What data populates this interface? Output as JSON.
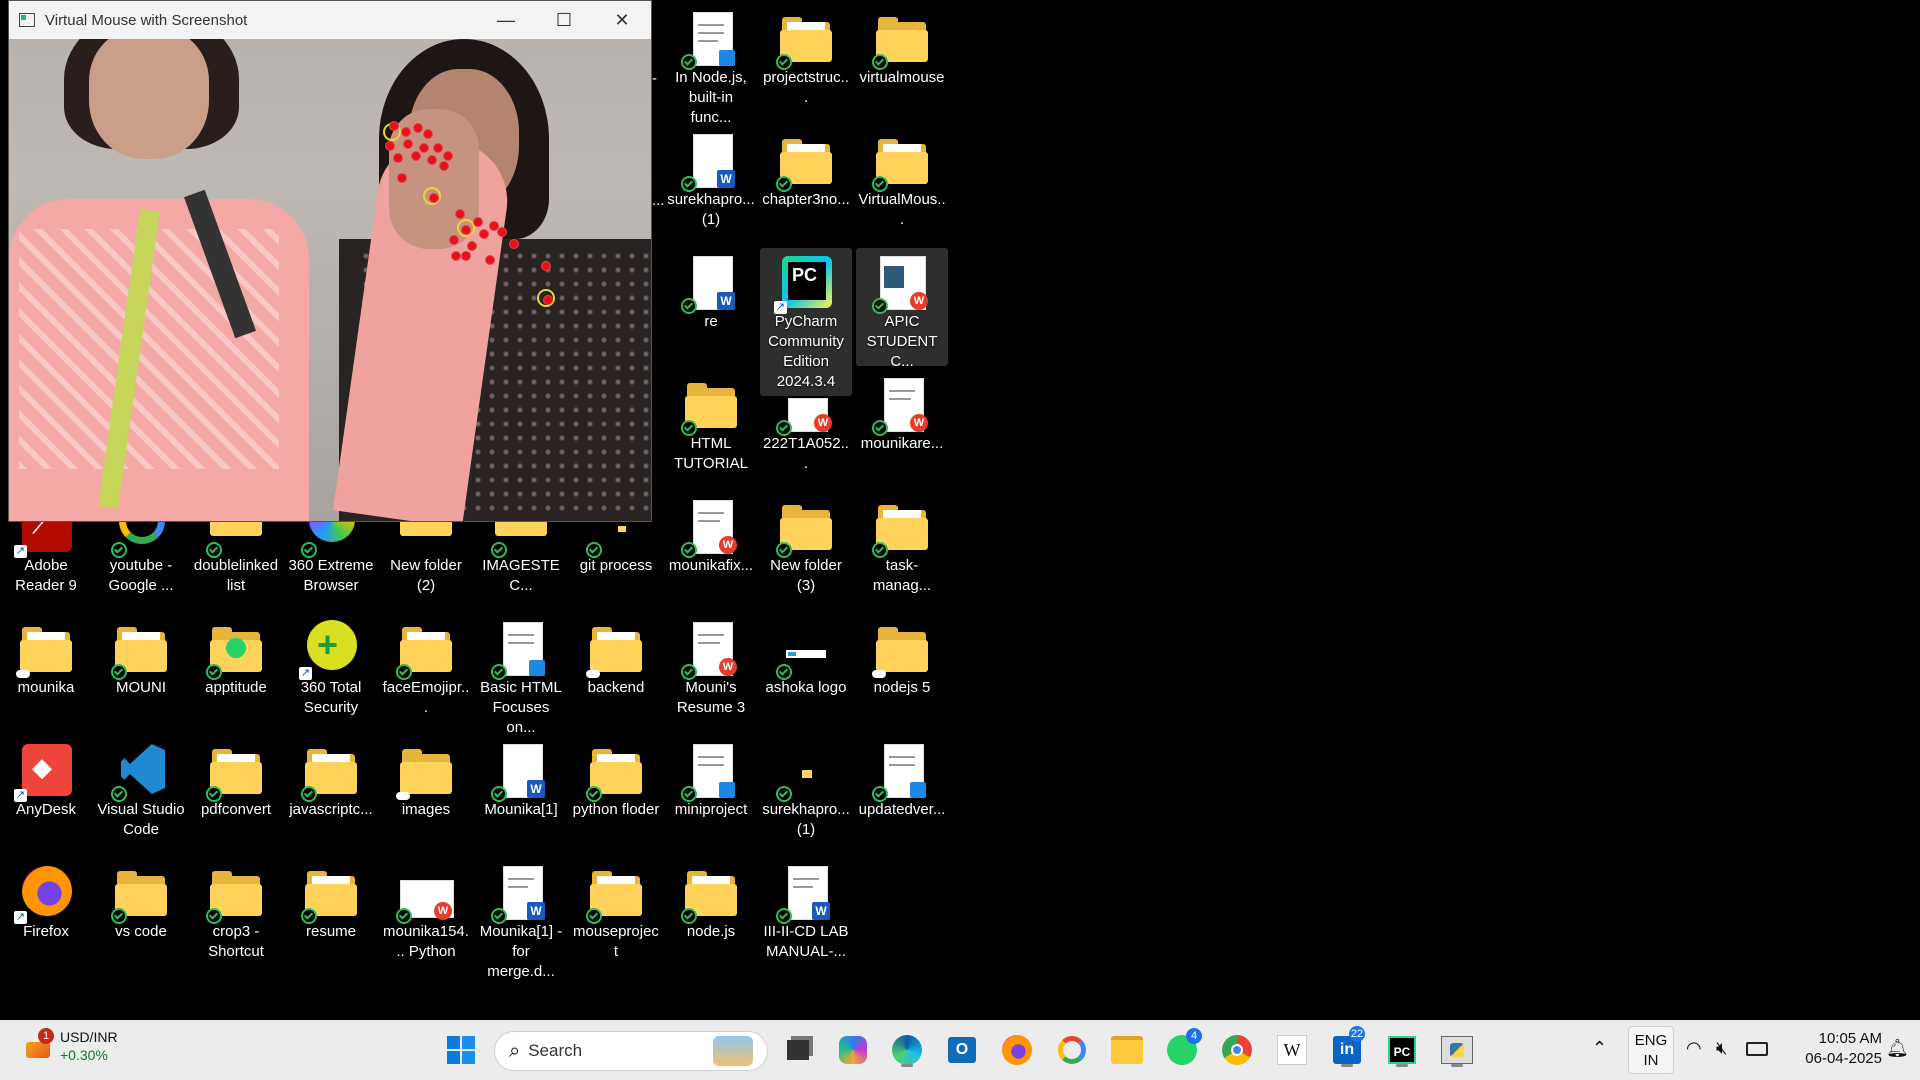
{
  "window": {
    "title": "Virtual Mouse with Screenshot",
    "minimize": "—",
    "maximize": "☐",
    "close": "✕"
  },
  "desktop_icons": [
    {
      "label": "In Node.js, built-in func...",
      "type": "doc-notepad",
      "status": "check"
    },
    {
      "label": "projectstruc...",
      "type": "folder",
      "status": "check"
    },
    {
      "label": "virtualmouse",
      "type": "folder",
      "status": "check"
    },
    {
      "label": "surekhapro... (1)",
      "type": "doc-word",
      "status": "check"
    },
    {
      "label": "chapter3no...",
      "type": "folder",
      "status": "check"
    },
    {
      "label": "VirtualMous...",
      "type": "folder",
      "status": "check"
    },
    {
      "label": "re",
      "type": "doc-word",
      "status": "check"
    },
    {
      "label": "PyCharm Community Edition 2024.3.4",
      "type": "app-pycharm",
      "status": "shortcut"
    },
    {
      "label": "APIC STUDENT C...",
      "type": "doc-wps",
      "status": "check"
    },
    {
      "label": "HTML TUTORIAL",
      "type": "folder",
      "status": "check"
    },
    {
      "label": "222T1A052...",
      "type": "doc-wps",
      "status": "check"
    },
    {
      "label": "mounikare...",
      "type": "doc-wps",
      "status": "check"
    },
    {
      "label": "Adobe Reader 9",
      "type": "app-adobe",
      "status": "shortcut"
    },
    {
      "label": "youtube - Google ...",
      "type": "app-google",
      "status": "check"
    },
    {
      "label": "doublelinked list",
      "type": "folder",
      "status": "check"
    },
    {
      "label": "360 Extreme Browser",
      "type": "app-360browser",
      "status": "check"
    },
    {
      "label": "New folder (2)",
      "type": "folder",
      "status": "check"
    },
    {
      "label": "IMAGESTEC...",
      "type": "folder",
      "status": "check"
    },
    {
      "label": "git process",
      "type": "folder",
      "status": "check"
    },
    {
      "label": "mounikafix...",
      "type": "doc-wps",
      "status": "check"
    },
    {
      "label": "New folder (3)",
      "type": "folder",
      "status": "check"
    },
    {
      "label": "task-manag...",
      "type": "folder",
      "status": "check"
    },
    {
      "label": "mounika",
      "type": "folder",
      "status": "cloud"
    },
    {
      "label": "MOUNI",
      "type": "folder",
      "status": "check"
    },
    {
      "label": "apptitude",
      "type": "folder-whatsapp",
      "status": "check"
    },
    {
      "label": "360 Total Security",
      "type": "app-360security",
      "status": "shortcut"
    },
    {
      "label": "faceEmojipr...",
      "type": "folder",
      "status": "check"
    },
    {
      "label": "Basic HTML Focuses on...",
      "type": "doc-notepad",
      "status": "check"
    },
    {
      "label": "backend",
      "type": "folder",
      "status": "cloud"
    },
    {
      "label": "Mouni's Resume 3",
      "type": "doc-wps",
      "status": "check"
    },
    {
      "label": "ashoka logo",
      "type": "image",
      "status": "check"
    },
    {
      "label": "nodejs 5",
      "type": "folder",
      "status": "cloud"
    },
    {
      "label": "AnyDesk",
      "type": "app-anydesk",
      "status": "shortcut"
    },
    {
      "label": "Visual Studio Code",
      "type": "app-vscode",
      "status": "check"
    },
    {
      "label": "pdfconvert",
      "type": "folder",
      "status": "check"
    },
    {
      "label": "javascriptc...",
      "type": "folder",
      "status": "check"
    },
    {
      "label": "images",
      "type": "folder",
      "status": "cloud"
    },
    {
      "label": "Mounika[1]",
      "type": "doc-word",
      "status": "check"
    },
    {
      "label": "python floder",
      "type": "folder",
      "status": "check"
    },
    {
      "label": "miniproject",
      "type": "doc-notepad",
      "status": "check"
    },
    {
      "label": "surekhapro... (1)",
      "type": "image-small",
      "status": "check"
    },
    {
      "label": "updatedver...",
      "type": "doc-notepad",
      "status": "check"
    },
    {
      "label": "Firefox",
      "type": "app-firefox",
      "status": "shortcut"
    },
    {
      "label": "vs code",
      "type": "folder",
      "status": "check"
    },
    {
      "label": "crop3 - Shortcut",
      "type": "folder",
      "status": "check"
    },
    {
      "label": "resume",
      "type": "folder",
      "status": "check"
    },
    {
      "label": "mounika154... Python",
      "type": "doc-wps",
      "status": "check"
    },
    {
      "label": "Mounika[1] - for merge.d...",
      "type": "doc-word",
      "status": "check"
    },
    {
      "label": "node.js",
      "type": "folder",
      "status": "check"
    },
    {
      "label": "mouseproject",
      "type": "folder",
      "status": "check"
    },
    {
      "label": "III-II-CD LAB MANUAL-...",
      "type": "doc-word",
      "status": "check"
    }
  ],
  "partial_left_column": [
    "-",
    "..."
  ],
  "taskbar": {
    "widget": {
      "symbol": "USD/INR",
      "change": "+0.30%",
      "badge": "1"
    },
    "search_placeholder": "Search",
    "apps": [
      {
        "name": "windows-start"
      },
      {
        "name": "task-view"
      },
      {
        "name": "copilot"
      },
      {
        "name": "edge"
      },
      {
        "name": "outlook"
      },
      {
        "name": "firefox"
      },
      {
        "name": "google"
      },
      {
        "name": "file-explorer"
      },
      {
        "name": "whatsapp",
        "badge": "4"
      },
      {
        "name": "chrome"
      },
      {
        "name": "wikipedia",
        "label": "W"
      },
      {
        "name": "linkedin",
        "badge": "22"
      },
      {
        "name": "pycharm",
        "label": "PC"
      },
      {
        "name": "python-idle"
      }
    ],
    "language": {
      "line1": "ENG",
      "line2": "IN"
    },
    "time": "10:05 AM",
    "date": "06-04-2025"
  },
  "colors": {
    "folder": "#ffd35b",
    "check": "#2dbd5c",
    "taskbar": "#ececec",
    "landmark": "#e5121b"
  }
}
